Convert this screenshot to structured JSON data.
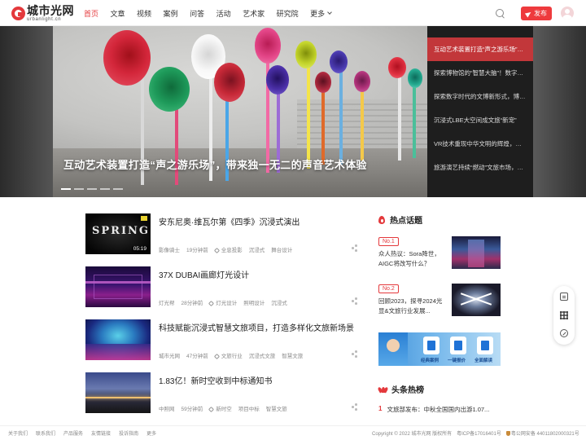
{
  "header": {
    "logo_cn": "城市光网",
    "logo_en": "urbanlight.cn",
    "nav": [
      "首页",
      "文章",
      "视频",
      "案例",
      "问答",
      "活动",
      "艺术家",
      "研究院"
    ],
    "more_label": "更多",
    "publish_label": "发布"
  },
  "banner": {
    "title": "互动艺术装置打造“声之游乐场”，带来独一无二的声音艺术体验",
    "side_items": [
      "互动艺术装置打造“声之游乐场”，带来独一无二的声音艺术体验",
      "探索博物馆的“智慧大脑”！数字化技术赋能博物馆",
      "探索数字时代的文博新形式，博物馆数字化",
      "沉浸式LBE大空间成文旅“新宠”",
      "VR技术重现中华文明的辉煌，沉浸式体验",
      "旅游演艺持续“燃动”文旅市场，夜游经济"
    ]
  },
  "articles": [
    {
      "title": "安东尼奥·维瓦尔第《四季》沉浸式演出",
      "source": "影像骑士",
      "time": "19分钟前",
      "tags": [
        "全息投影",
        "沉浸式",
        "舞台设计"
      ],
      "thumb_text": "SPRING",
      "duration": "05:19"
    },
    {
      "title": "37X DUBAI画廊灯光设计",
      "source": "灯光帮",
      "time": "28分钟前",
      "tags": [
        "灯光设计",
        "照明设计",
        "沉浸式"
      ]
    },
    {
      "title": "科技赋能沉浸式智慧文旅项目，打造多样化文旅新场景",
      "source": "城市光网",
      "time": "47分钟前",
      "tags": [
        "文旅行业",
        "沉浸式文旅",
        "智慧文旅"
      ]
    },
    {
      "title": "1.83亿！新时空收到中标通知书",
      "source": "中照网",
      "time": "59分钟前",
      "tags": [
        "新时空",
        "项目中标",
        "智慧文旅"
      ]
    }
  ],
  "hot": {
    "heading": "热点话题",
    "items": [
      {
        "badge": "No.1",
        "text": "众人热议：Sora降世，AIGC将改写什么？"
      },
      {
        "badge": "No.2",
        "text": "回顾2023，探寻2024光显&文旅行业发展..."
      }
    ]
  },
  "ad": {
    "labels": [
      "经典案例",
      "一键报价",
      "全面解读"
    ]
  },
  "top_news": {
    "heading": "头条热榜",
    "items": [
      {
        "num": "1",
        "text": "文旅部发布：中秋全国国内出游1.07..."
      }
    ]
  },
  "footer": {
    "links": [
      "关于我们",
      "联系我们",
      "产品服务",
      "友情链接",
      "投诉指南",
      "更多"
    ],
    "copyright": "Copyright © 2022 城市光网 版权所有",
    "icp": "粤ICP备17016401号",
    "police": "粤公网安备 44011802000321号"
  },
  "colors": {
    "accent": "#e4393c",
    "banner_side_bg": "#1e1e1e"
  }
}
